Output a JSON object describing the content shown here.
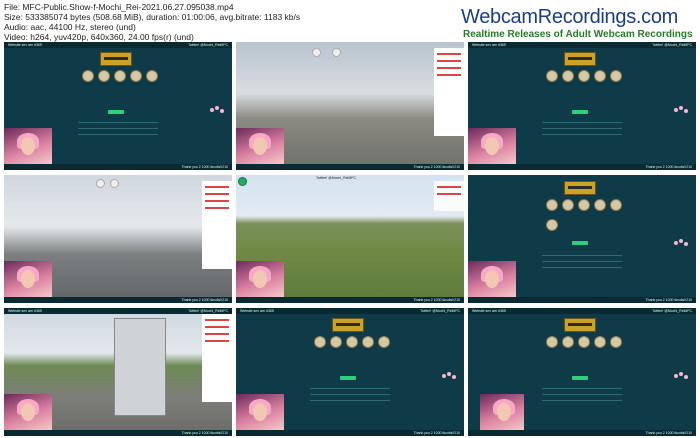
{
  "meta": {
    "file": "File: MFC-Public.Show-f-Mochi_Rei-2021.06.27.095038.mp4",
    "size": "Size: 533385074 bytes (508.68 MiB), duration: 01:00:06, avg.bitrate: 1183 kb/s",
    "audio": "Audio: aac, 44100 Hz, stereo (und)",
    "video": "Video: h264, yuv420p, 640x360, 24.00 fps(r) (und)"
  },
  "brand": {
    "name": "WebcamRecordings.com",
    "tagline": "Realtime Releases of Adult Webcam Recordings"
  },
  "thumbs": {
    "top_text": "Website sex are #365",
    "top_right": "Twitter! @Mochi_ReiMFC",
    "bottom_text": "Thank you 2 1000 tkcoils!!210"
  }
}
